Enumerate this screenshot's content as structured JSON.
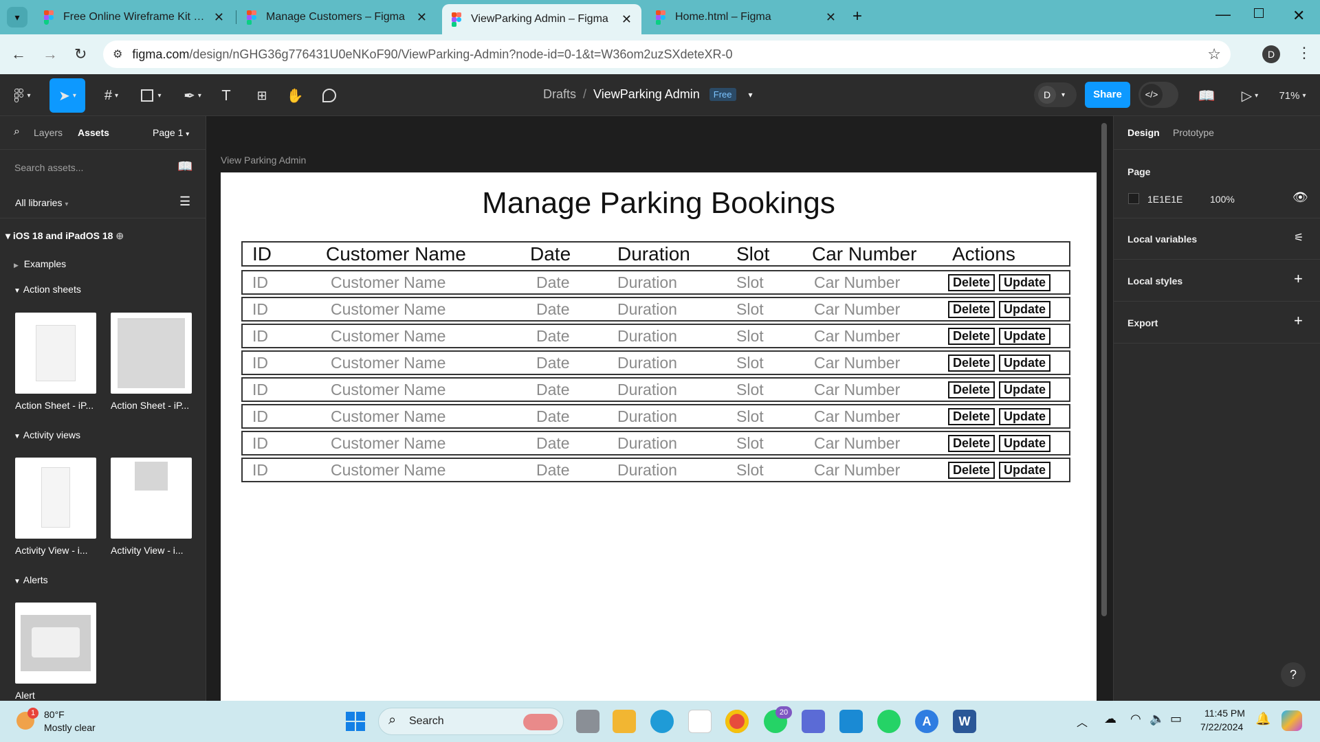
{
  "browser": {
    "tabs": [
      {
        "title": "Free Online Wireframe Kit | Figma"
      },
      {
        "title": "Manage Customers – Figma"
      },
      {
        "title": "ViewParking Admin – Figma"
      },
      {
        "title": "Home.html – Figma"
      }
    ],
    "url_domain": "figma.com",
    "url_path": "/design/nGHG36g776431U0eNKoF90/ViewParking-Admin?node-id=0-1&t=W36om2uzSXdeteXR-0",
    "profile_initial": "D"
  },
  "figma": {
    "breadcrumb_root": "Drafts",
    "breadcrumb_sep": "/",
    "file_name": "ViewParking Admin",
    "plan_badge": "Free",
    "avatar_initial": "D",
    "share_label": "Share",
    "zoom": "71%"
  },
  "left_panel": {
    "tabs": {
      "layers": "Layers",
      "assets": "Assets"
    },
    "page_selector": "Page 1",
    "search_placeholder": "Search assets...",
    "libraries": "All libraries",
    "library_name": "iOS 18 and iPadOS 18",
    "sections": [
      {
        "name": "Examples"
      },
      {
        "name": "Action sheets",
        "items": [
          "Action Sheet - iP...",
          "Action Sheet - iP..."
        ]
      },
      {
        "name": "Activity views",
        "items": [
          "Activity View - i...",
          "Activity View - i..."
        ]
      },
      {
        "name": "Alerts",
        "items": [
          "Alert"
        ]
      }
    ]
  },
  "canvas": {
    "frame_label": "View Parking Admin",
    "page_title": "Manage Parking Bookings",
    "headers": [
      "ID",
      "Customer Name",
      "Date",
      "Duration",
      "Slot",
      "Car Number",
      "Actions"
    ],
    "row_placeholder": [
      "ID",
      "Customer Name",
      "Date",
      "Duration",
      "Slot",
      "Car Number"
    ],
    "row_count": 8,
    "delete_label": "Delete",
    "update_label": "Update"
  },
  "right_panel": {
    "tabs": {
      "design": "Design",
      "prototype": "Prototype"
    },
    "page_heading": "Page",
    "page_color": "1E1E1E",
    "page_opacity": "100%",
    "local_variables": "Local variables",
    "local_styles": "Local styles",
    "export": "Export"
  },
  "taskbar": {
    "weather_temp": "80°F",
    "weather_desc": "Mostly clear",
    "weather_badge": "1",
    "search_label": "Search",
    "whatsapp_badge": "20",
    "time": "11:45 PM",
    "date": "7/22/2024"
  },
  "colors": {
    "tabbar": "#5fbcc6",
    "figma_blue": "#0d99ff",
    "panel": "#2c2c2c",
    "canvas": "#1e1e1e"
  }
}
